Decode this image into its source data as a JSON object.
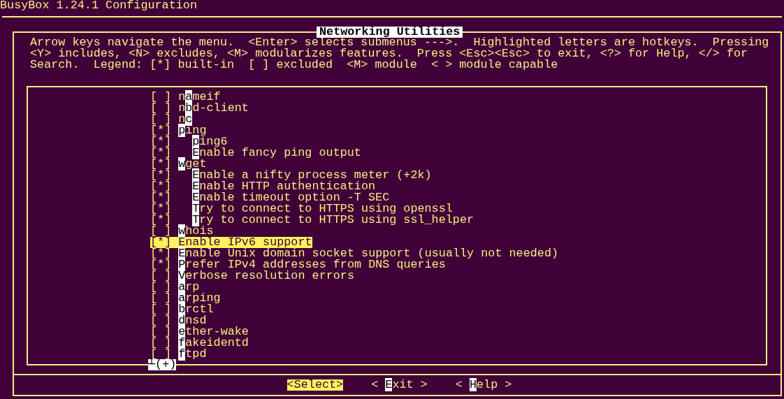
{
  "window": {
    "title": "BusyBox 1.24.1 Configuration"
  },
  "dialog": {
    "title": "Networking Utilities",
    "help": [
      "Arrow keys navigate the menu.  <Enter> selects submenus --->.  Highlighted letters are hotkeys.  Pressing",
      "<Y> includes, <N> excludes, <M> modularizes features.  Press <Esc><Esc> to exit, <?> for Help, </> for",
      "Search.  Legend: [*] built-in  [ ] excluded  <M> module  < > module capable"
    ],
    "items": [
      {
        "mark": "[ ]",
        "before": "n",
        "hotkey": "a",
        "after": "meif",
        "selected": false
      },
      {
        "mark": "[ ]",
        "before": "n",
        "hotkey": "b",
        "after": "d-client",
        "selected": false
      },
      {
        "mark": "[ ]",
        "before": "n",
        "hotkey": "c",
        "selected": false
      },
      {
        "mark": "[*]",
        "hotkey": "p",
        "after": "ing",
        "selected": false,
        "children": [
          {
            "mark": "[*]",
            "hotkey": "p",
            "after": "ing6",
            "selected": false
          },
          {
            "mark": "[*]",
            "hotkey": "E",
            "after": "nable fancy ping output",
            "selected": false
          }
        ]
      },
      {
        "mark": "[*]",
        "hotkey": "w",
        "after": "get",
        "selected": false,
        "children": [
          {
            "mark": "[*]",
            "hotkey": "E",
            "after": "nable a nifty process meter (+2k)",
            "selected": false
          },
          {
            "mark": "[*]",
            "hotkey": "E",
            "after": "nable HTTP authentication",
            "selected": false
          },
          {
            "mark": "[*]",
            "hotkey": "E",
            "after": "nable timeout option -T SEC",
            "selected": false
          },
          {
            "mark": "[*]",
            "hotkey": "T",
            "after": "ry to connect to HTTPS using openssl",
            "selected": false
          },
          {
            "mark": "[*]",
            "hotkey": "T",
            "after": "ry to connect to HTTPS using ssl_helper",
            "selected": false
          }
        ]
      },
      {
        "mark": "[ ]",
        "hotkey": "w",
        "after": "hois",
        "selected": false
      },
      {
        "mark": "[*]",
        "hotkey": "E",
        "after": "nable IPv6 support",
        "selected": true
      },
      {
        "mark": "[*]",
        "hotkey": "E",
        "after": "nable Unix domain socket support (usually not needed)",
        "selected": false
      },
      {
        "mark": "[*]",
        "hotkey": "P",
        "after": "refer IPv4 addresses from DNS queries",
        "selected": false
      },
      {
        "mark": "[ ]",
        "hotkey": "V",
        "after": "erbose resolution errors",
        "selected": false
      },
      {
        "mark": "[ ]",
        "hotkey": "a",
        "after": "rp",
        "selected": false
      },
      {
        "mark": "[ ]",
        "hotkey": "a",
        "after": "rping",
        "selected": false
      },
      {
        "mark": "[ ]",
        "hotkey": "b",
        "after": "rctl",
        "selected": false
      },
      {
        "mark": "[ ]",
        "hotkey": "d",
        "after": "nsd",
        "selected": false
      },
      {
        "mark": "[ ]",
        "hotkey": "e",
        "after": "ther-wake",
        "selected": false
      },
      {
        "mark": "[ ]",
        "hotkey": "f",
        "after": "akeidentd",
        "selected": false
      },
      {
        "mark": "[ ]",
        "hotkey": "f",
        "after": "tpd",
        "selected": false
      }
    ],
    "scroll_indicator": "┴(+)",
    "buttons": [
      {
        "before": "<",
        "hotkey": "S",
        "after": "elect>",
        "selected": true
      },
      {
        "before": "< ",
        "hotkey": "E",
        "after": "xit >",
        "selected": false
      },
      {
        "before": "< ",
        "hotkey": "H",
        "after": "elp >",
        "selected": false
      }
    ]
  }
}
